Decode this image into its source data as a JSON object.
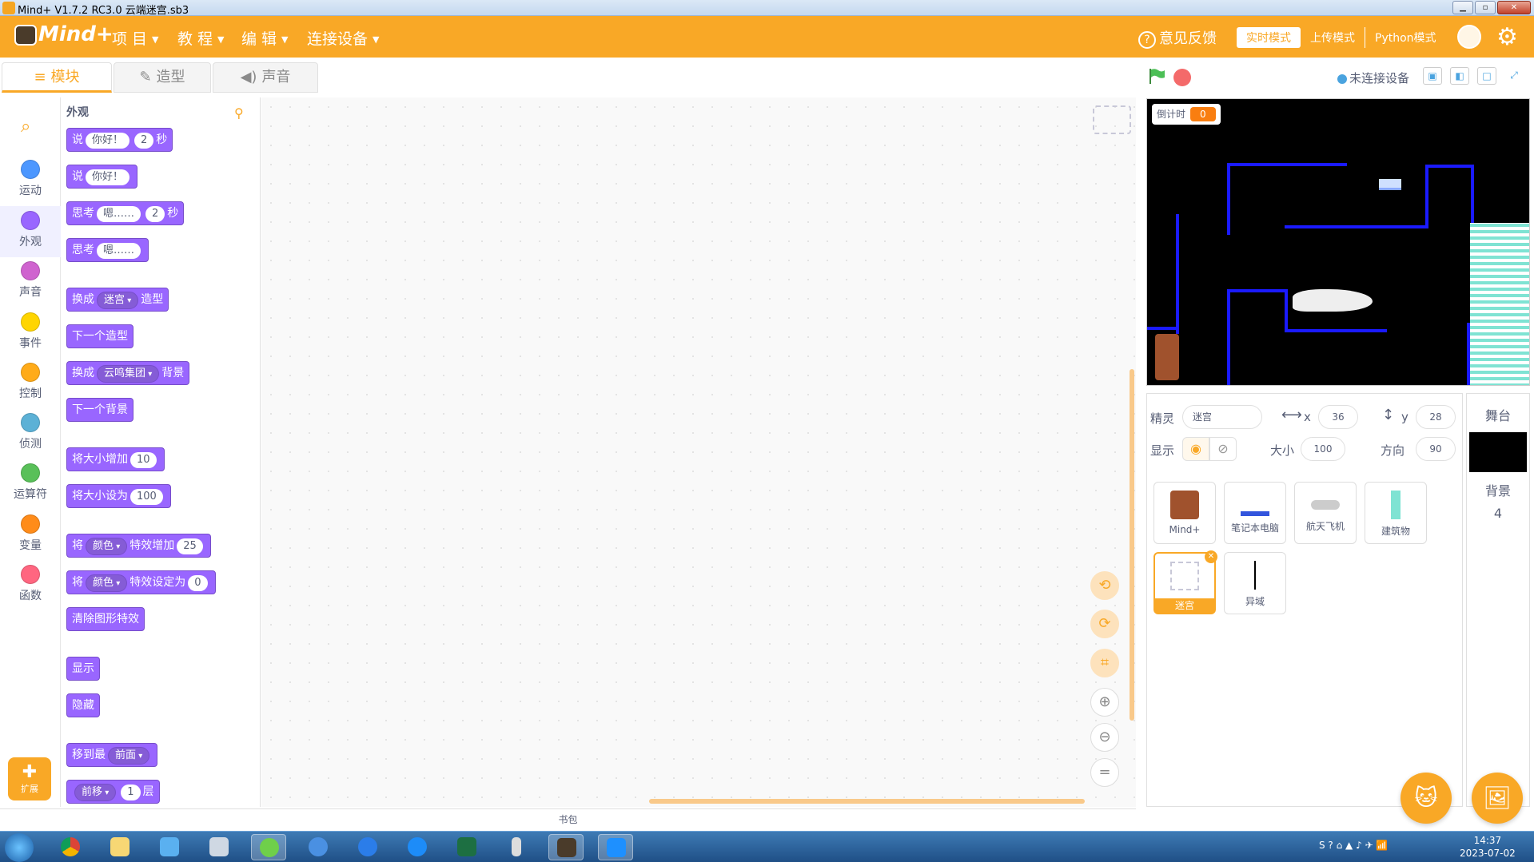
{
  "window": {
    "title": "Mind+ V1.7.2 RC3.0   云端迷宫.sb3"
  },
  "menubar": {
    "logo": "Mind+",
    "menus": [
      "项 目",
      "教 程",
      "编 辑",
      "连接设备"
    ],
    "feedback": "意见反馈",
    "modes": [
      "实时模式",
      "上传模式",
      "Python模式"
    ],
    "accent": "#f9a826"
  },
  "tabs": [
    "模块",
    "造型",
    "声音"
  ],
  "stage_header": {
    "device_status": "未连接设备"
  },
  "categories": [
    {
      "label": "运动",
      "color": "#4c97ff"
    },
    {
      "label": "外观",
      "color": "#9966ff"
    },
    {
      "label": "声音",
      "color": "#cf63cf"
    },
    {
      "label": "事件",
      "color": "#ffd500"
    },
    {
      "label": "控制",
      "color": "#ffab19"
    },
    {
      "label": "侦测",
      "color": "#5cb1d6"
    },
    {
      "label": "运算符",
      "color": "#59c059"
    },
    {
      "label": "变量",
      "color": "#ff8c1a"
    },
    {
      "label": "函数",
      "color": "#ff6680"
    }
  ],
  "extension_label": "扩展",
  "palette": {
    "title": "外观",
    "blocks": {
      "say_secs": {
        "a": "说",
        "msg": "你好！",
        "secs": "2",
        "b": "秒"
      },
      "say": {
        "a": "说",
        "msg": "你好！"
      },
      "think_secs": {
        "a": "思考",
        "msg": "嗯……",
        "secs": "2",
        "b": "秒"
      },
      "think": {
        "a": "思考",
        "msg": "嗯……"
      },
      "switch_costume": {
        "a": "换成",
        "dd": "迷宫",
        "b": "造型"
      },
      "next_costume": "下一个造型",
      "switch_backdrop": {
        "a": "换成",
        "dd": "云鸣集团",
        "b": "背景"
      },
      "next_backdrop": "下一个背景",
      "change_size": {
        "a": "将大小增加",
        "val": "10"
      },
      "set_size": {
        "a": "将大小设为",
        "val": "100"
      },
      "change_effect": {
        "a": "将",
        "dd": "颜色",
        "b": "特效增加",
        "val": "25"
      },
      "set_effect": {
        "a": "将",
        "dd": "颜色",
        "b": "特效设定为",
        "val": "0"
      },
      "clear_effects": "清除图形特效",
      "show": "显示",
      "hide": "隐藏",
      "go_to_layer": {
        "a": "移到最",
        "dd": "前面"
      },
      "go_layer": {
        "dd": "前移",
        "val": "1",
        "b": "层"
      }
    }
  },
  "backpack": "书包",
  "stage": {
    "timer_label": "倒计时",
    "timer_value": "0"
  },
  "sprite_info": {
    "sprite_label": "精灵",
    "sprite_name": "迷宫",
    "x_label": "x",
    "x": "36",
    "y_label": "y",
    "y": "28",
    "show_label": "显示",
    "size_label": "大小",
    "size": "100",
    "direction_label": "方向",
    "direction": "90"
  },
  "sprites": [
    "Mind+",
    "笔记本电脑",
    "航天飞机",
    "建筑物",
    "迷宫",
    "异域"
  ],
  "stage_panel": {
    "title": "舞台",
    "backdrops_label": "背景",
    "backdrop_count": "4"
  },
  "taskbar": {
    "time": "14:37",
    "date": "2023-07-02"
  }
}
